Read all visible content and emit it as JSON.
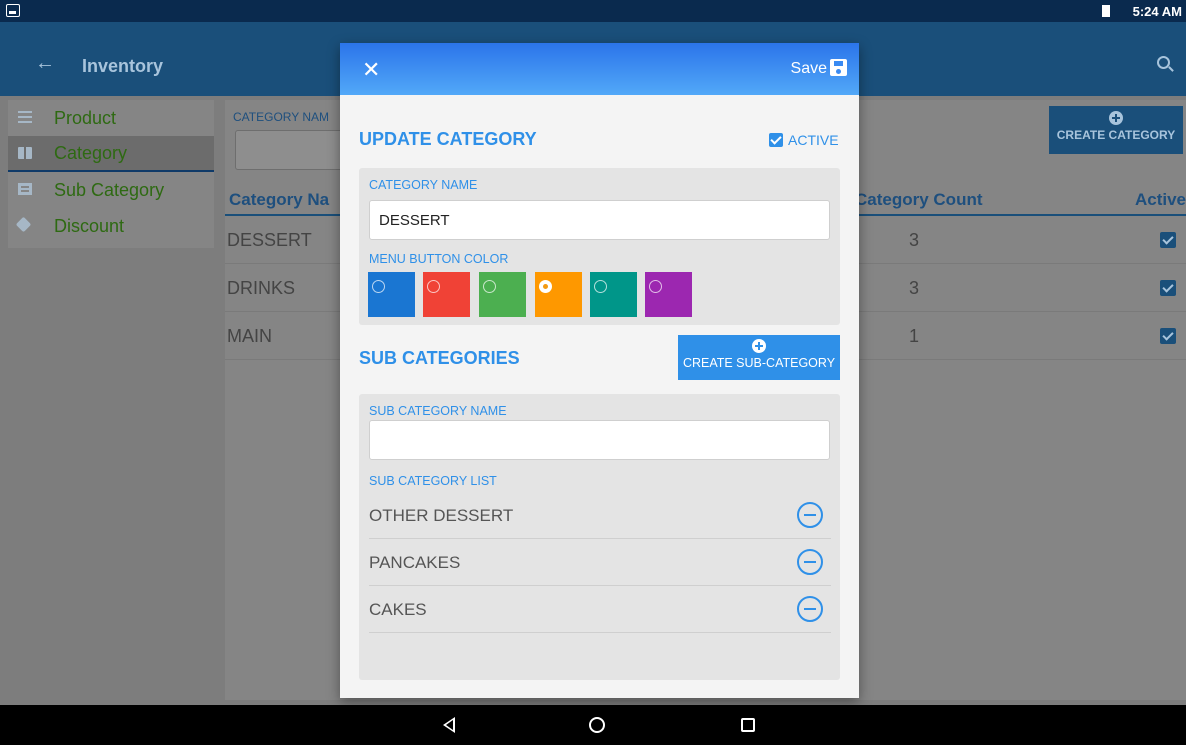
{
  "status_bar": {
    "time": "5:24 AM",
    "gallery_icon": "image-icon",
    "battery_icon": "battery-icon"
  },
  "app_bar": {
    "title": "Inventory",
    "back_icon": "arrow-left-icon",
    "search_icon": "search-icon"
  },
  "sidebar": {
    "items": [
      {
        "label": "Product",
        "icon": "list-icon",
        "active": false
      },
      {
        "label": "Category",
        "icon": "book-icon",
        "active": true
      },
      {
        "label": "Sub Category",
        "icon": "card-icon",
        "active": false
      },
      {
        "label": "Discount",
        "icon": "tag-icon",
        "active": false
      }
    ]
  },
  "main": {
    "category_name_label": "CATEGORY NAM",
    "create_category_label": "CREATE CATEGORY",
    "table": {
      "headers": {
        "name": "Category Na",
        "count": "Category Count",
        "active": "Active"
      },
      "rows": [
        {
          "name": "DESSERT",
          "count": "3",
          "active": true
        },
        {
          "name": "DRINKS",
          "count": "3",
          "active": true
        },
        {
          "name": "MAIN",
          "count": "1",
          "active": true
        }
      ]
    }
  },
  "dialog": {
    "close_icon": "close-icon",
    "save_label": "Save",
    "save_icon": "floppy-disk-icon",
    "title": "UPDATE CATEGORY",
    "active_label": "ACTIVE",
    "active_checked": true,
    "category_name_label": "CATEGORY NAME",
    "category_name_value": "DESSERT",
    "menu_button_color_label": "MENU BUTTON COLOR",
    "colors": [
      {
        "hex": "#1a76d2",
        "selected": false
      },
      {
        "hex": "#f04236",
        "selected": false
      },
      {
        "hex": "#4caf50",
        "selected": false
      },
      {
        "hex": "#fe9800",
        "selected": true
      },
      {
        "hex": "#009689",
        "selected": false
      },
      {
        "hex": "#9c27b0",
        "selected": false
      }
    ],
    "sub_categories_title": "SUB CATEGORIES",
    "create_sub_category_label": "CREATE SUB-CATEGORY",
    "sub_category_name_label": "SUB CATEGORY NAME",
    "sub_category_name_value": "",
    "sub_category_list_label": "SUB CATEGORY LIST",
    "sub_categories": [
      "OTHER DESSERT",
      "PANCAKES",
      "CAKES"
    ]
  },
  "nav_bar": {
    "back_icon": "nav-back-icon",
    "home_icon": "nav-home-icon",
    "recents_icon": "nav-recents-icon"
  }
}
